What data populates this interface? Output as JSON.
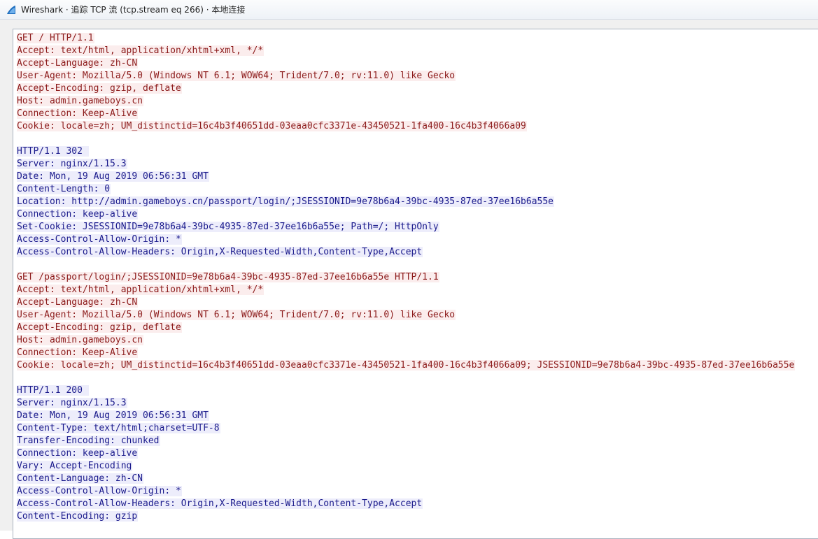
{
  "window": {
    "title": "Wireshark · 追踪 TCP 流 (tcp.stream eq 266) · 本地连接",
    "icon": "wireshark-fin-icon"
  },
  "colors": {
    "client_bg": "#fbeded",
    "client_fg": "#8c1b1b",
    "server_bg": "#ededfb",
    "server_fg": "#1b1b8c"
  },
  "stream": {
    "blocks": [
      {
        "direction": "client",
        "lines": [
          "GET / HTTP/1.1",
          "Accept: text/html, application/xhtml+xml, */*",
          "Accept-Language: zh-CN",
          "User-Agent: Mozilla/5.0 (Windows NT 6.1; WOW64; Trident/7.0; rv:11.0) like Gecko",
          "Accept-Encoding: gzip, deflate",
          "Host: admin.gameboys.cn",
          "Connection: Keep-Alive",
          "Cookie: locale=zh; UM_distinctid=16c4b3f40651dd-03eaa0cfc3371e-43450521-1fa400-16c4b3f4066a09"
        ]
      },
      {
        "direction": "server",
        "lines": [
          "HTTP/1.1 302 ",
          "Server: nginx/1.15.3",
          "Date: Mon, 19 Aug 2019 06:56:31 GMT",
          "Content-Length: 0",
          "Location: http://admin.gameboys.cn/passport/login/;JSESSIONID=9e78b6a4-39bc-4935-87ed-37ee16b6a55e",
          "Connection: keep-alive",
          "Set-Cookie: JSESSIONID=9e78b6a4-39bc-4935-87ed-37ee16b6a55e; Path=/; HttpOnly",
          "Access-Control-Allow-Origin: *",
          "Access-Control-Allow-Headers: Origin,X-Requested-Width,Content-Type,Accept"
        ]
      },
      {
        "direction": "client",
        "lines": [
          "GET /passport/login/;JSESSIONID=9e78b6a4-39bc-4935-87ed-37ee16b6a55e HTTP/1.1",
          "Accept: text/html, application/xhtml+xml, */*",
          "Accept-Language: zh-CN",
          "User-Agent: Mozilla/5.0 (Windows NT 6.1; WOW64; Trident/7.0; rv:11.0) like Gecko",
          "Accept-Encoding: gzip, deflate",
          "Host: admin.gameboys.cn",
          "Connection: Keep-Alive",
          "Cookie: locale=zh; UM_distinctid=16c4b3f40651dd-03eaa0cfc3371e-43450521-1fa400-16c4b3f4066a09; JSESSIONID=9e78b6a4-39bc-4935-87ed-37ee16b6a55e"
        ]
      },
      {
        "direction": "server",
        "lines": [
          "HTTP/1.1 200 ",
          "Server: nginx/1.15.3",
          "Date: Mon, 19 Aug 2019 06:56:31 GMT",
          "Content-Type: text/html;charset=UTF-8",
          "Transfer-Encoding: chunked",
          "Connection: keep-alive",
          "Vary: Accept-Encoding",
          "Content-Language: zh-CN",
          "Access-Control-Allow-Origin: *",
          "Access-Control-Allow-Headers: Origin,X-Requested-Width,Content-Type,Accept",
          "Content-Encoding: gzip"
        ]
      }
    ]
  }
}
